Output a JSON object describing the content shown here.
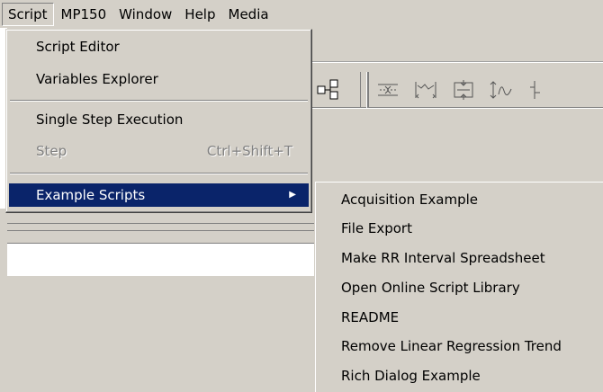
{
  "menubar": {
    "items": [
      {
        "label": "Script",
        "open": true
      },
      {
        "label": "MP150"
      },
      {
        "label": "Window"
      },
      {
        "label": "Help"
      },
      {
        "label": "Media"
      }
    ]
  },
  "script_menu": {
    "items": [
      {
        "label": "Script Editor"
      },
      {
        "label": "Variables Explorer"
      },
      {
        "label": "Single Step Execution"
      },
      {
        "label": "Step",
        "shortcut": "Ctrl+Shift+T",
        "disabled": true
      },
      {
        "label": "Example Scripts",
        "selected": true,
        "submenu_arrow": "▶"
      }
    ]
  },
  "example_scripts_submenu": {
    "items": [
      {
        "label": "Acquisition Example"
      },
      {
        "label": "File Export"
      },
      {
        "label": "Make RR Interval Spreadsheet"
      },
      {
        "label": "Open Online Script Library"
      },
      {
        "label": "README"
      },
      {
        "label": "Remove Linear Regression Trend"
      },
      {
        "label": "Rich Dialog Example"
      }
    ]
  },
  "toolbar": {
    "icons": [
      "connect-channels-icon",
      "compress-vertical-icon",
      "expand-horizontal-icon",
      "zoom-fit-icon",
      "waveform-tool-icon",
      "partial-tool-icon"
    ]
  },
  "colors": {
    "menu_bg": "#d4d0c8",
    "selection_bg": "#0a246a",
    "disabled_text": "#808080"
  }
}
